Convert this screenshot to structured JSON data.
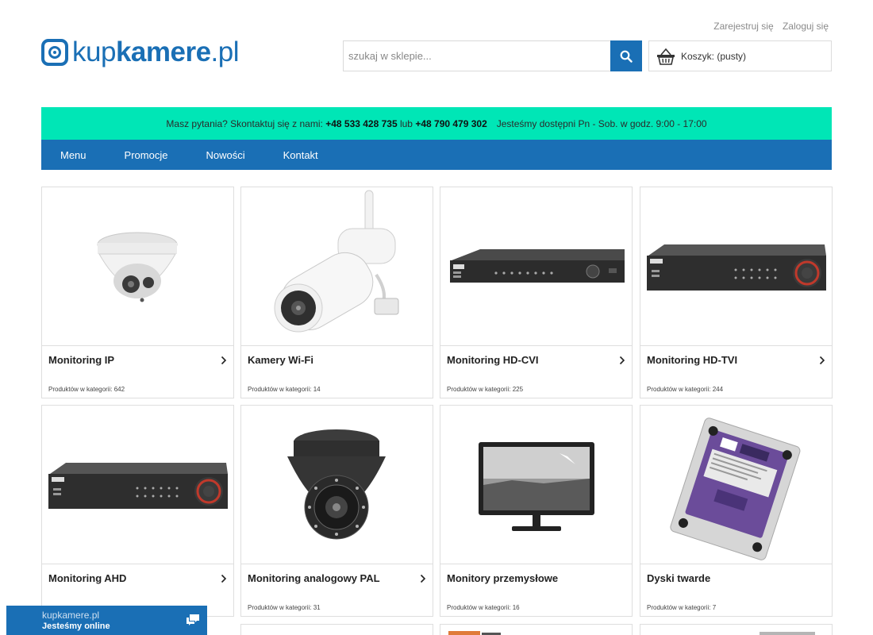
{
  "header": {
    "register_link": "Zarejestruj się",
    "login_link": "Zaloguj się",
    "logo_light1": "kup",
    "logo_bold": "kamere",
    "logo_light2": ".pl"
  },
  "search": {
    "placeholder": "szukaj w sklepie..."
  },
  "cart": {
    "label": "Koszyk: (pusty)"
  },
  "info_bar": {
    "prefix": "Masz pytania? Skontaktuj się z nami:",
    "phone1": "+48 533 428 735",
    "or": "lub",
    "phone2": "+48 790 479 302",
    "hours": "Jesteśmy dostępni Pn - Sob. w godz. 9:00 - 17:00"
  },
  "nav": {
    "items": [
      "Menu",
      "Promocje",
      "Nowości",
      "Kontakt"
    ]
  },
  "categories": [
    {
      "name": "Monitoring IP",
      "count": "Produktów w kategorii: 642",
      "has_arrow": true,
      "image": "dome-ip-camera"
    },
    {
      "name": "Kamery Wi-Fi",
      "count": "Produktów w kategorii: 14",
      "has_arrow": false,
      "image": "wifi-bullet-camera"
    },
    {
      "name": "Monitoring HD-CVI",
      "count": "Produktów w kategorii: 225",
      "has_arrow": true,
      "image": "recorder"
    },
    {
      "name": "Monitoring HD-TVI",
      "count": "Produktów w kategorii: 244",
      "has_arrow": true,
      "image": "recorder-red-knob"
    },
    {
      "name": "Monitoring AHD",
      "count": "",
      "has_arrow": true,
      "image": "recorder-red-knob"
    },
    {
      "name": "Monitoring analogowy PAL",
      "count": "Produktów w kategorii: 31",
      "has_arrow": true,
      "image": "black-dome-camera"
    },
    {
      "name": "Monitory przemysłowe",
      "count": "Produktów w kategorii: 16",
      "has_arrow": false,
      "image": "monitor"
    },
    {
      "name": "Dyski twarde",
      "count": "Produktów w kategorii: 7",
      "has_arrow": false,
      "image": "hard-drive"
    }
  ],
  "chat": {
    "site": "kupkamere.pl",
    "status": "Jesteśmy online"
  },
  "colors": {
    "brand_blue": "#1a6fb5",
    "info_bar": "#00e6b6"
  }
}
